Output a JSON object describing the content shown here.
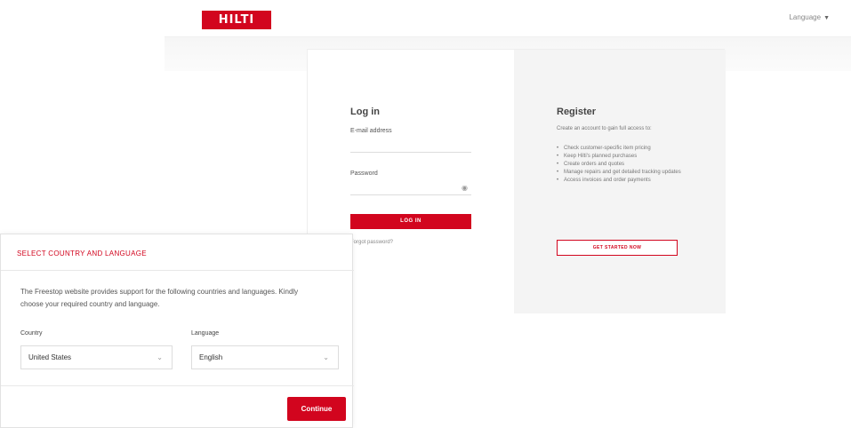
{
  "header": {
    "logo_text": "HILTI",
    "language_selector": "Language"
  },
  "login": {
    "title": "Log in",
    "email_label": "E-mail address",
    "password_label": "Password",
    "login_button": "LOG IN",
    "forgot_link": "Forgot password?"
  },
  "register": {
    "title": "Register",
    "intro": "Create an account to gain full access to:",
    "benefits": [
      "Check customer-specific item pricing",
      "Keep Hilti's planned purchases",
      "Create orders and quotes",
      "Manage repairs and get detailed tracking updates",
      "Access invoices and order payments"
    ],
    "button": "GET STARTED NOW"
  },
  "modal": {
    "title": "SELECT COUNTRY AND LANGUAGE",
    "text": "The Freestop website provides support for the following countries and languages. Kindly choose your required country and language.",
    "country_label": "Country",
    "country_value": "United States",
    "language_label": "Language",
    "language_value": "English",
    "continue_button": "Continue"
  },
  "colors": {
    "brand_red": "#d2051e"
  }
}
